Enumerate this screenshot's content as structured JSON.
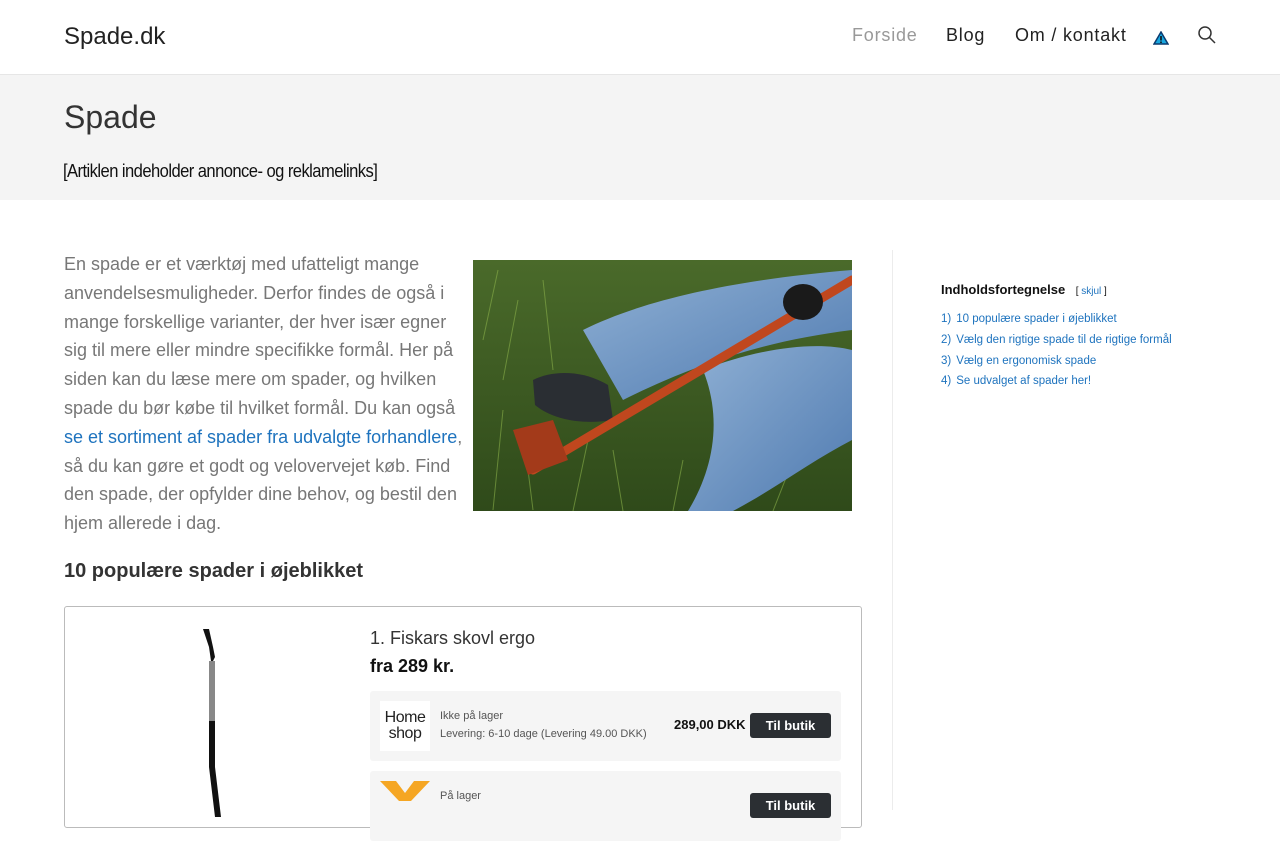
{
  "header": {
    "logo": "Spade.dk",
    "nav": [
      {
        "label": "Forside"
      },
      {
        "label": "Blog"
      },
      {
        "label": "Om / kontakt"
      }
    ]
  },
  "page": {
    "title": "Spade",
    "disclaimer": "[Artiklen indeholder annonce- og reklamelinks]"
  },
  "intro": {
    "text_before": "En spade er et værktøj med ufatteligt mange anvendelsesmuligheder. Derfor findes de også i mange forskellige varianter, der hver især egner sig til mere eller mindre specifikke formål. Her på siden kan du læse mere om spader, og hvilken spade du bør købe til hvilket formål. Du kan også ",
    "link_text": "se et sortiment af spader fra udvalgte forhandlere",
    "text_after": ", så du kan gøre et godt og velovervejet køb. Find den spade, der opfylder dine behov, og bestil den hjem allerede i dag."
  },
  "section": {
    "heading": "10 populære spader i øjeblikket"
  },
  "product": {
    "name": "1. Fiskars skovl ergo",
    "price": "fra 289 kr.",
    "offers": [
      {
        "shop_logo_line1": "Home",
        "shop_logo_line2": "shop",
        "stock": "Ikke på lager",
        "delivery": "Levering: 6-10 dage (Levering 49.00 DKK)",
        "price": "289,00 DKK",
        "button": "Til butik"
      },
      {
        "stock": "På lager",
        "button": "Til butik"
      }
    ]
  },
  "toc": {
    "title": "Indholdsfortegnelse",
    "toggle_open": "[",
    "toggle_label": "skjul",
    "toggle_close": "]",
    "items": [
      {
        "num": "1)",
        "label": "10 populære spader i øjeblikket"
      },
      {
        "num": "2)",
        "label": "Vælg den rigtige spade til de rigtige formål"
      },
      {
        "num": "3)",
        "label": "Vælg en ergonomisk spade"
      },
      {
        "num": "4)",
        "label": "Se udvalget af spader her!"
      }
    ]
  },
  "colors": {
    "link": "#1e73be",
    "button": "#2b2f33",
    "header_band": "#f4f4f4",
    "nav_active": "#999999"
  },
  "icons": [
    "warning-triangle-icon",
    "search-icon"
  ]
}
